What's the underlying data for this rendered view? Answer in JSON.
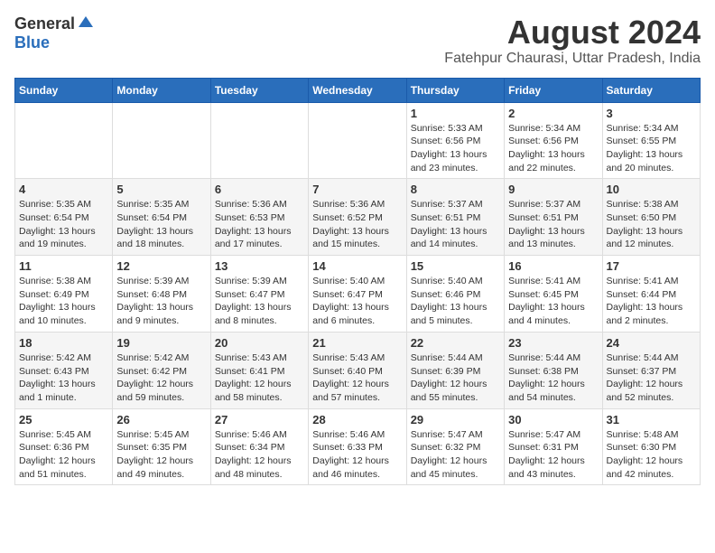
{
  "header": {
    "logo_general": "General",
    "logo_blue": "Blue",
    "month_title": "August 2024",
    "location": "Fatehpur Chaurasi, Uttar Pradesh, India"
  },
  "weekdays": [
    "Sunday",
    "Monday",
    "Tuesday",
    "Wednesday",
    "Thursday",
    "Friday",
    "Saturday"
  ],
  "weeks": [
    [
      {
        "day": "",
        "info": ""
      },
      {
        "day": "",
        "info": ""
      },
      {
        "day": "",
        "info": ""
      },
      {
        "day": "",
        "info": ""
      },
      {
        "day": "1",
        "info": "Sunrise: 5:33 AM\nSunset: 6:56 PM\nDaylight: 13 hours\nand 23 minutes."
      },
      {
        "day": "2",
        "info": "Sunrise: 5:34 AM\nSunset: 6:56 PM\nDaylight: 13 hours\nand 22 minutes."
      },
      {
        "day": "3",
        "info": "Sunrise: 5:34 AM\nSunset: 6:55 PM\nDaylight: 13 hours\nand 20 minutes."
      }
    ],
    [
      {
        "day": "4",
        "info": "Sunrise: 5:35 AM\nSunset: 6:54 PM\nDaylight: 13 hours\nand 19 minutes."
      },
      {
        "day": "5",
        "info": "Sunrise: 5:35 AM\nSunset: 6:54 PM\nDaylight: 13 hours\nand 18 minutes."
      },
      {
        "day": "6",
        "info": "Sunrise: 5:36 AM\nSunset: 6:53 PM\nDaylight: 13 hours\nand 17 minutes."
      },
      {
        "day": "7",
        "info": "Sunrise: 5:36 AM\nSunset: 6:52 PM\nDaylight: 13 hours\nand 15 minutes."
      },
      {
        "day": "8",
        "info": "Sunrise: 5:37 AM\nSunset: 6:51 PM\nDaylight: 13 hours\nand 14 minutes."
      },
      {
        "day": "9",
        "info": "Sunrise: 5:37 AM\nSunset: 6:51 PM\nDaylight: 13 hours\nand 13 minutes."
      },
      {
        "day": "10",
        "info": "Sunrise: 5:38 AM\nSunset: 6:50 PM\nDaylight: 13 hours\nand 12 minutes."
      }
    ],
    [
      {
        "day": "11",
        "info": "Sunrise: 5:38 AM\nSunset: 6:49 PM\nDaylight: 13 hours\nand 10 minutes."
      },
      {
        "day": "12",
        "info": "Sunrise: 5:39 AM\nSunset: 6:48 PM\nDaylight: 13 hours\nand 9 minutes."
      },
      {
        "day": "13",
        "info": "Sunrise: 5:39 AM\nSunset: 6:47 PM\nDaylight: 13 hours\nand 8 minutes."
      },
      {
        "day": "14",
        "info": "Sunrise: 5:40 AM\nSunset: 6:47 PM\nDaylight: 13 hours\nand 6 minutes."
      },
      {
        "day": "15",
        "info": "Sunrise: 5:40 AM\nSunset: 6:46 PM\nDaylight: 13 hours\nand 5 minutes."
      },
      {
        "day": "16",
        "info": "Sunrise: 5:41 AM\nSunset: 6:45 PM\nDaylight: 13 hours\nand 4 minutes."
      },
      {
        "day": "17",
        "info": "Sunrise: 5:41 AM\nSunset: 6:44 PM\nDaylight: 13 hours\nand 2 minutes."
      }
    ],
    [
      {
        "day": "18",
        "info": "Sunrise: 5:42 AM\nSunset: 6:43 PM\nDaylight: 13 hours\nand 1 minute."
      },
      {
        "day": "19",
        "info": "Sunrise: 5:42 AM\nSunset: 6:42 PM\nDaylight: 12 hours\nand 59 minutes."
      },
      {
        "day": "20",
        "info": "Sunrise: 5:43 AM\nSunset: 6:41 PM\nDaylight: 12 hours\nand 58 minutes."
      },
      {
        "day": "21",
        "info": "Sunrise: 5:43 AM\nSunset: 6:40 PM\nDaylight: 12 hours\nand 57 minutes."
      },
      {
        "day": "22",
        "info": "Sunrise: 5:44 AM\nSunset: 6:39 PM\nDaylight: 12 hours\nand 55 minutes."
      },
      {
        "day": "23",
        "info": "Sunrise: 5:44 AM\nSunset: 6:38 PM\nDaylight: 12 hours\nand 54 minutes."
      },
      {
        "day": "24",
        "info": "Sunrise: 5:44 AM\nSunset: 6:37 PM\nDaylight: 12 hours\nand 52 minutes."
      }
    ],
    [
      {
        "day": "25",
        "info": "Sunrise: 5:45 AM\nSunset: 6:36 PM\nDaylight: 12 hours\nand 51 minutes."
      },
      {
        "day": "26",
        "info": "Sunrise: 5:45 AM\nSunset: 6:35 PM\nDaylight: 12 hours\nand 49 minutes."
      },
      {
        "day": "27",
        "info": "Sunrise: 5:46 AM\nSunset: 6:34 PM\nDaylight: 12 hours\nand 48 minutes."
      },
      {
        "day": "28",
        "info": "Sunrise: 5:46 AM\nSunset: 6:33 PM\nDaylight: 12 hours\nand 46 minutes."
      },
      {
        "day": "29",
        "info": "Sunrise: 5:47 AM\nSunset: 6:32 PM\nDaylight: 12 hours\nand 45 minutes."
      },
      {
        "day": "30",
        "info": "Sunrise: 5:47 AM\nSunset: 6:31 PM\nDaylight: 12 hours\nand 43 minutes."
      },
      {
        "day": "31",
        "info": "Sunrise: 5:48 AM\nSunset: 6:30 PM\nDaylight: 12 hours\nand 42 minutes."
      }
    ]
  ]
}
